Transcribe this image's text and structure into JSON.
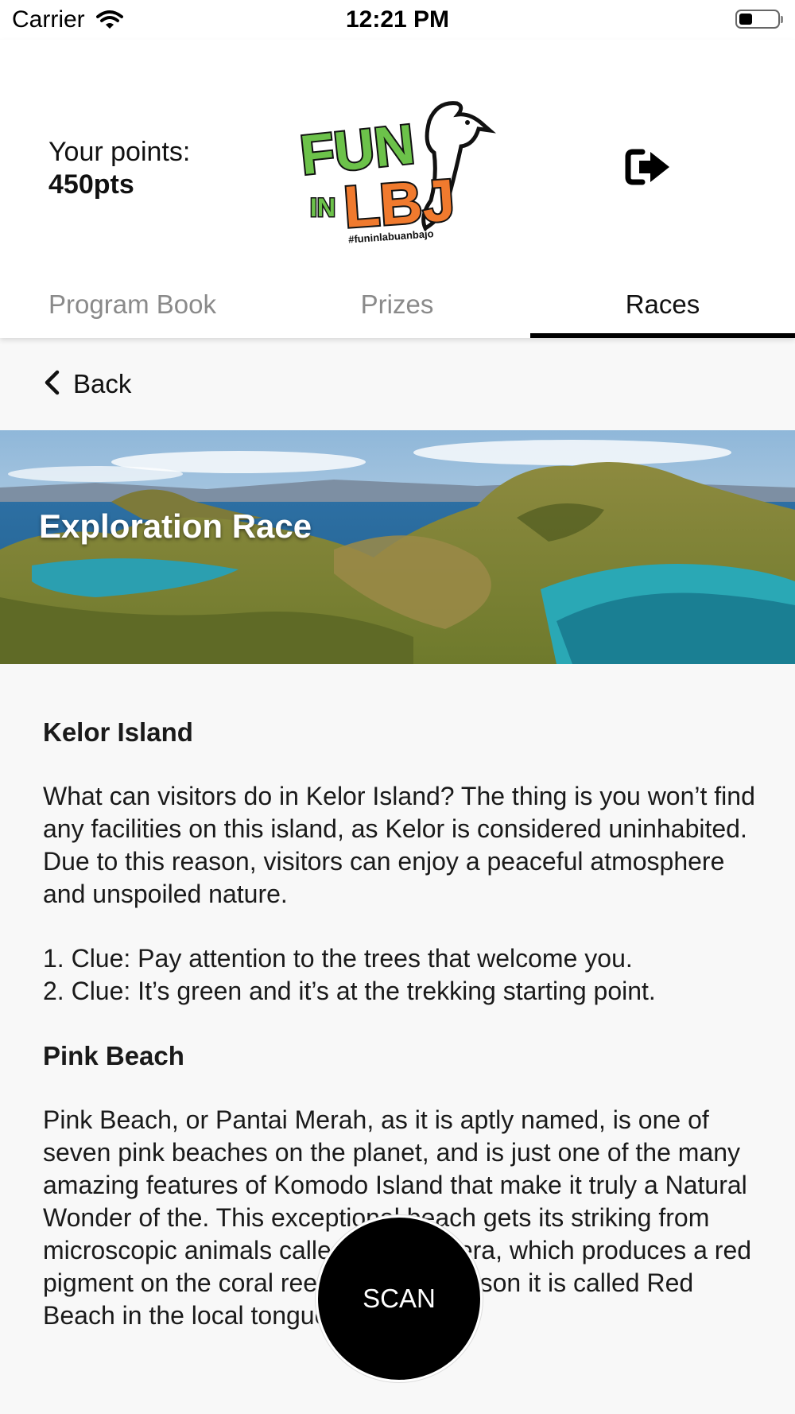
{
  "status_bar": {
    "carrier": "Carrier",
    "time": "12:21 PM",
    "battery_level": 0.35
  },
  "header": {
    "points_label": "Your points:",
    "points_value": "450pts",
    "logo": {
      "line1": "FUN",
      "line2_small": "IN",
      "line2": "LBJ",
      "hashtag": "#funinlabuanbajo",
      "colors": {
        "green": "#6cc24a",
        "orange": "#f07a2e",
        "outline": "#111111"
      }
    }
  },
  "tabs": [
    {
      "label": "Program Book",
      "active": false
    },
    {
      "label": "Prizes",
      "active": false
    },
    {
      "label": "Races",
      "active": true
    }
  ],
  "nav": {
    "back_label": "Back"
  },
  "banner": {
    "title": "Exploration Race"
  },
  "sections": [
    {
      "title": "Kelor Island",
      "description": "What can visitors do in Kelor Island? The thing is you won’t find any facilities on this island, as Kelor is considered uninhabited. Due to this reason, visitors can enjoy a peaceful atmosphere and unspoiled nature.",
      "clues": [
        "1. Clue: Pay attention to the trees that welcome you.",
        "2. Clue: It’s green and it’s at the trekking starting point."
      ]
    },
    {
      "title": "Pink Beach",
      "description": "Pink Beach, or Pantai Merah, as it is aptly named, is one of seven pink beaches on the planet, and is just one of the many amazing features of Komodo Island that make it truly a Natural Wonder of the. This exceptional beach gets its striking from microscopic animals called Foraminifera, which produces a red pigment on the coral reefs. For this reason it is called Red Beach in the local tongue."
    }
  ],
  "scan_button": {
    "label": "SCAN"
  },
  "colors": {
    "accent": "#000000",
    "background": "#f8f8f8",
    "inactive_tab": "#8a8a8a"
  }
}
